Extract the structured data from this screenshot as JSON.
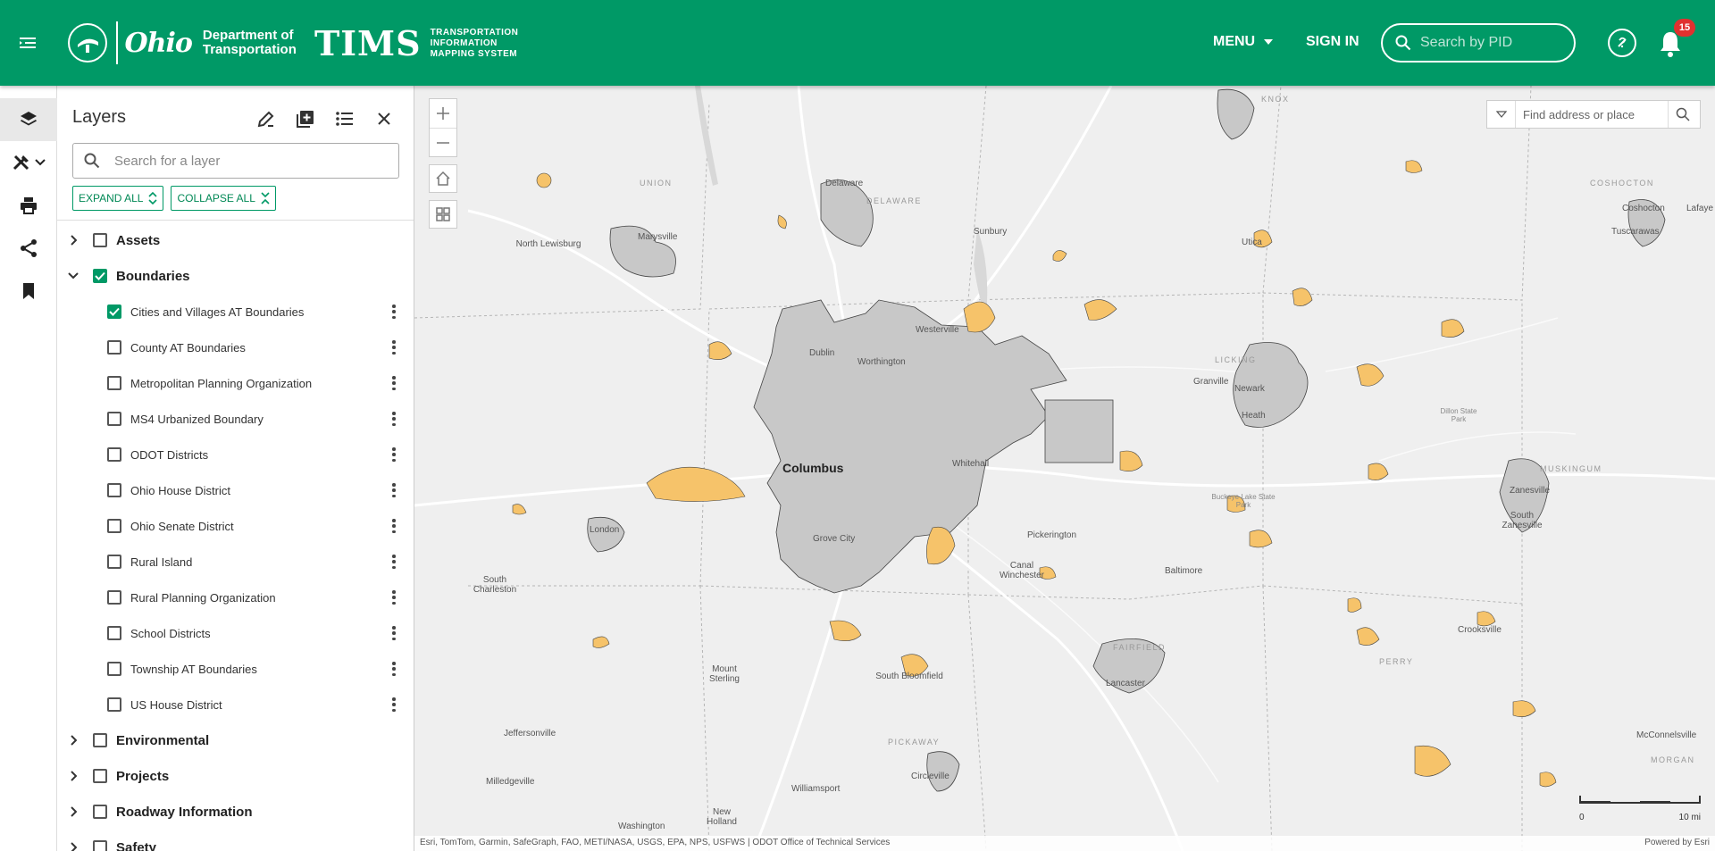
{
  "header": {
    "logo_ohio": "Ohio",
    "logo_dept_line1": "Department of",
    "logo_dept_line2": "Transportation",
    "tims_title": "TIMS",
    "tims_sub1": "TRANSPORTATION",
    "tims_sub2": "INFORMATION",
    "tims_sub3": "MAPPING SYSTEM",
    "menu_label": "MENU",
    "signin_label": "SIGN IN",
    "pid_placeholder": "Search by PID",
    "notification_count": "15"
  },
  "layers_panel": {
    "title": "Layers",
    "search_placeholder": "Search for a layer",
    "expand_all": "EXPAND ALL",
    "collapse_all": "COLLAPSE ALL",
    "groups": [
      {
        "label": "Assets",
        "expanded": false,
        "checked": false
      },
      {
        "label": "Boundaries",
        "expanded": true,
        "checked": true
      },
      {
        "label": "Environmental",
        "expanded": false,
        "checked": false
      },
      {
        "label": "Projects",
        "expanded": false,
        "checked": false
      },
      {
        "label": "Roadway Information",
        "expanded": false,
        "checked": false
      },
      {
        "label": "Safety",
        "expanded": false,
        "checked": false
      }
    ],
    "boundaries_children": [
      {
        "label": "Cities and Villages AT Boundaries",
        "checked": true
      },
      {
        "label": "County AT Boundaries",
        "checked": false
      },
      {
        "label": "Metropolitan Planning Organization",
        "checked": false
      },
      {
        "label": "MS4 Urbanized Boundary",
        "checked": false
      },
      {
        "label": "ODOT Districts",
        "checked": false
      },
      {
        "label": "Ohio House District",
        "checked": false
      },
      {
        "label": "Ohio Senate District",
        "checked": false
      },
      {
        "label": "Rural Island",
        "checked": false
      },
      {
        "label": "Rural Planning Organization",
        "checked": false
      },
      {
        "label": "School Districts",
        "checked": false
      },
      {
        "label": "Township AT Boundaries",
        "checked": false
      },
      {
        "label": "US House District",
        "checked": false
      }
    ]
  },
  "map": {
    "find_placeholder": "Find address or place",
    "attribution": "Esri, TomTom, Garmin, SafeGraph, FAO, METI/NASA, USGS, EPA, NPS, USFWS | ODOT Office of Technical Services",
    "powered_by": "Powered by Esri",
    "scale_start": "0",
    "scale_end": "10 mi",
    "labels": {
      "columbus": "Columbus",
      "delaware": "Delaware",
      "sunbury": "Sunbury",
      "marysville": "Marysville",
      "north_lewisburg": "North Lewisburg",
      "westerville": "Westerville",
      "worthington": "Worthington",
      "dublin": "Dublin",
      "whitehall": "Whitehall",
      "grove_city": "Grove City",
      "pickerington": "Pickerington",
      "canal_winchester": "Canal Winchester",
      "london": "London",
      "south_charleston": "South Charleston",
      "newark": "Newark",
      "heath": "Heath",
      "granville": "Granville",
      "utica": "Utica",
      "lancaster": "Lancaster",
      "baltimore": "Baltimore",
      "zanesville": "Zanesville",
      "south_zanesville": "South Zanesville",
      "crooksville": "Crooksville",
      "coshocton": "Coshocton",
      "mount_sterling": "Mount Sterling",
      "south_bloomfield": "South Bloomfield",
      "circleville": "Circleville",
      "williamsport": "Williamsport",
      "new_holland": "New Holland",
      "jeffersonville": "Jeffersonville",
      "milledgeville": "Milledgeville",
      "washington": "Washington",
      "mcconnelsville": "McConnelsville",
      "union": "UNION",
      "delaware_cty": "DELAWARE",
      "licking": "LICKING",
      "fairfield": "FAIRFIELD",
      "perry": "PERRY",
      "pickaway": "PICKAWAY",
      "muskingum": "MUSKINGUM",
      "morgan": "MORGAN",
      "coshocton_cty": "COSHOCTON",
      "knox": "KNOX",
      "dillon": "Dillon State Park",
      "buckeye": "Buckeye Lake State Park",
      "tuscarawas": "Tuscarawas",
      "lafayette": "Lafaye"
    }
  },
  "colors": {
    "brand_green": "#009966",
    "city_fill": "#c8c8c8",
    "village_fill": "#f6c36a",
    "badge_red": "#e0312f"
  }
}
